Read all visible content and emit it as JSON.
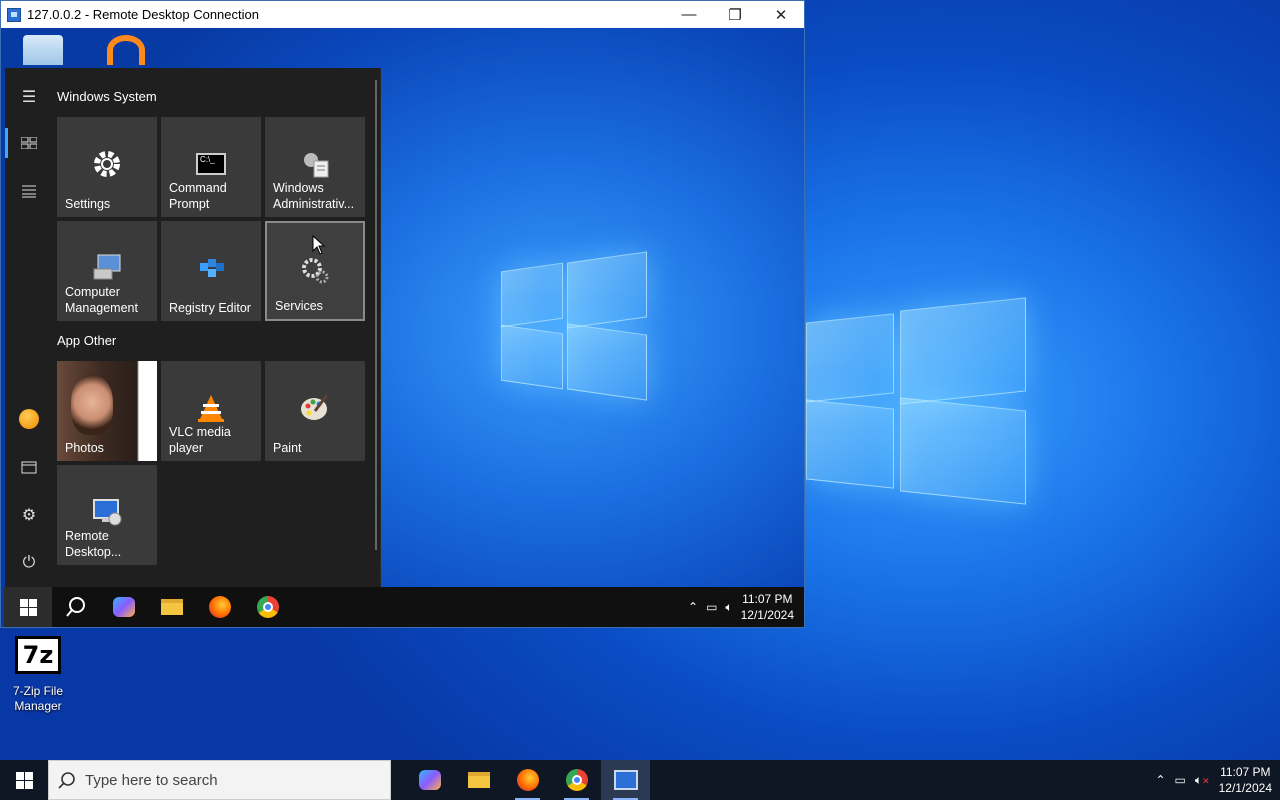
{
  "rdp_window": {
    "title": "127.0.0.2 - Remote Desktop Connection",
    "controls": {
      "minimize": "—",
      "restore": "❐",
      "close": "✕"
    }
  },
  "start_menu": {
    "group1_title": "Windows System",
    "group2_title": "App Other",
    "tiles_system": [
      {
        "label": "Settings",
        "icon": "gear-icon"
      },
      {
        "label": "Command Prompt",
        "icon": "cmd-icon"
      },
      {
        "label": "Windows Administrativ...",
        "icon": "admin-tools-icon"
      },
      {
        "label": "Computer Management",
        "icon": "computer-management-icon"
      },
      {
        "label": "Registry Editor",
        "icon": "registry-icon"
      },
      {
        "label": "Services",
        "icon": "services-gear-icon"
      }
    ],
    "tiles_other": [
      {
        "label": "Photos",
        "icon": "photos-tile"
      },
      {
        "label": "VLC media player",
        "icon": "vlc-icon"
      },
      {
        "label": "Paint",
        "icon": "paint-icon"
      },
      {
        "label": "Remote Desktop...",
        "icon": "remote-desktop-icon"
      }
    ],
    "rail_icons": [
      "hamburger-icon",
      "tiles-icon",
      "list-icon",
      "user-avatar-icon",
      "documents-icon",
      "settings-icon",
      "power-icon"
    ]
  },
  "guest_taskbar": {
    "time": "11:07 PM",
    "date": "12/1/2024",
    "app_icons": [
      "windows-start-icon",
      "search-icon",
      "copilot-icon",
      "file-explorer-icon",
      "firefox-icon",
      "chrome-icon"
    ]
  },
  "host_desktop": {
    "icon_label": "7-Zip File Manager",
    "icon_glyph": "7z"
  },
  "host_taskbar": {
    "search_placeholder": "Type here to search",
    "time": "11:07 PM",
    "date": "12/1/2024",
    "app_icons": [
      "copilot-icon",
      "file-explorer-icon",
      "firefox-icon",
      "chrome-icon",
      "remote-desktop-icon"
    ]
  }
}
